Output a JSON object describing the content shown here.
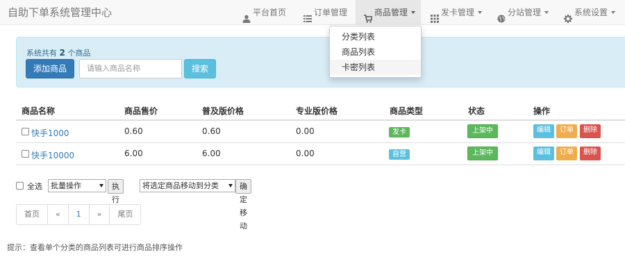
{
  "header": {
    "brand": "自助下单系统管理中心",
    "nav": [
      {
        "label": "平台首页",
        "icon": "user-icon"
      },
      {
        "label": "订单管理",
        "icon": "list-icon"
      },
      {
        "label": "商品管理",
        "icon": "cart-icon"
      },
      {
        "label": "发卡管理",
        "icon": "grid-icon"
      },
      {
        "label": "分站管理",
        "icon": "globe-icon"
      },
      {
        "label": "系统设置",
        "icon": "gear-icon"
      }
    ]
  },
  "dropdown": {
    "items": [
      "分类列表",
      "商品列表",
      "卡密列表"
    ]
  },
  "panel": {
    "count_prefix": "系统共有",
    "count": "2",
    "count_suffix": "个商品",
    "add_button": "添加商品",
    "search_placeholder": "请输入商品名称",
    "search_button": "搜索"
  },
  "table": {
    "headers": [
      "商品名称",
      "商品售价",
      "普及版价格",
      "专业版价格",
      "商品类型",
      "状态",
      "操作"
    ],
    "rows": [
      {
        "name": "快手1000",
        "price": "0.60",
        "basic_price": "0.60",
        "pro_price": "0.00",
        "type": "发卡",
        "type_color": "#5cb85c",
        "status": "上架中",
        "actions": [
          "编辑",
          "订单",
          "删除"
        ]
      },
      {
        "name": "快手10000",
        "price": "6.00",
        "basic_price": "6.00",
        "pro_price": "0.00",
        "type": "自营",
        "type_color": "#5bc0de",
        "status": "上架中",
        "actions": [
          "编辑",
          "订单",
          "删除"
        ]
      }
    ]
  },
  "batch": {
    "select_all": "全选",
    "batch_select": "批量操作",
    "execute": "执行",
    "move_select": "将选定商品移动到分类",
    "confirm_move": "确定移动"
  },
  "pagination": {
    "first": "首页",
    "prev": "«",
    "current": "1",
    "next": "»",
    "last": "尾页"
  },
  "tip": "提示：查看单个分类的商品列表可进行商品排序操作",
  "colors": {
    "primary": "#337ab7",
    "info": "#5bc0de",
    "success": "#5cb85c",
    "warning": "#f0ad4e",
    "danger": "#d9534f",
    "panel_bg": "#d9edf7"
  }
}
